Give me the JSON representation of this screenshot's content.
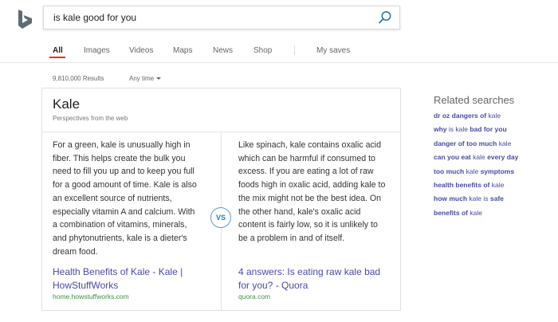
{
  "search": {
    "query": "is kale good for you"
  },
  "tabs": [
    {
      "label": "All",
      "active": true
    },
    {
      "label": "Images",
      "active": false
    },
    {
      "label": "Videos",
      "active": false
    },
    {
      "label": "Maps",
      "active": false
    },
    {
      "label": "News",
      "active": false
    },
    {
      "label": "Shop",
      "active": false
    },
    {
      "label": "My saves",
      "active": false
    }
  ],
  "results": {
    "count_text": "9,810,000 Results",
    "time_filter": "Any time"
  },
  "card": {
    "title": "Kale",
    "subtitle": "Perspectives from the web",
    "vs_label": "VS",
    "left": {
      "text": "For a green, kale is unusually high in fiber. This helps create the bulk you need to fill you up and to keep you full for a good amount of time. Kale is also an excellent source of nutrients, especially vitamin A and calcium. With a combination of vitamins, minerals, and phytonutrients, kale is a dieter's dream food.",
      "link": "Health Benefits of Kale - Kale | HowStuffWorks",
      "url": "home.howstuffworks.com"
    },
    "right": {
      "text": "Like spinach, kale contains oxalic acid which can be harmful if consumed to excess. If you are eating a lot of raw foods high in oxalic acid, adding kale to the mix might not be the best idea. On the other hand, kale's oxalic acid content is fairly low, so it is unlikely to be a problem in and of itself.",
      "link": "4 answers: Is eating raw kale bad for you? - Quora",
      "url": "quora.com"
    }
  },
  "related": {
    "title": "Related searches",
    "items": [
      {
        "bold1": "dr oz dangers of",
        "plain": " kale",
        "bold2": ""
      },
      {
        "bold1": "why",
        "plain": " is kale ",
        "bold2": "bad for you"
      },
      {
        "bold1": "danger of too much",
        "plain": " kale",
        "bold2": ""
      },
      {
        "bold1": "can you eat",
        "plain": " kale ",
        "bold2": "every day"
      },
      {
        "bold1": "too much",
        "plain": " kale ",
        "bold2": "symptoms"
      },
      {
        "bold1": "health benefits of",
        "plain": " kale",
        "bold2": ""
      },
      {
        "bold1": "how much",
        "plain": " kale is ",
        "bold2": "safe"
      },
      {
        "bold1": "benefits of",
        "plain": " kale",
        "bold2": ""
      }
    ]
  },
  "colors": {
    "brand_accent": "#d83b01",
    "link": "#4a4aa6",
    "url_green": "#3f8f3f",
    "vs_blue": "#2a7ab9"
  },
  "icons": {
    "logo": "bing-logo-icon",
    "search": "magnifier-icon",
    "dropdown": "caret-down-icon"
  }
}
